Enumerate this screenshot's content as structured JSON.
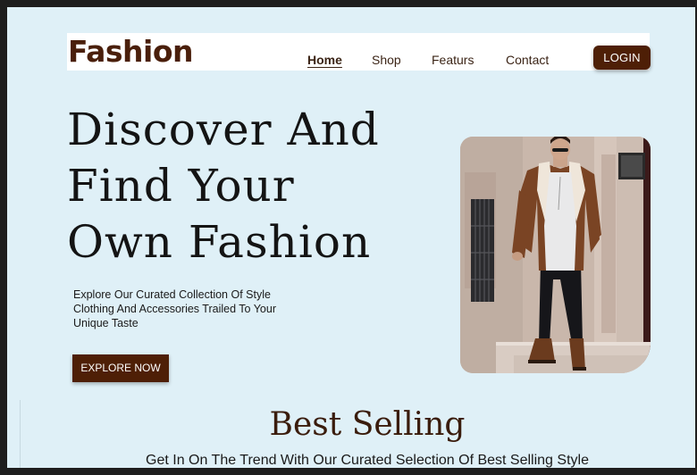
{
  "header": {
    "logo": "Fashion",
    "nav": [
      "Home",
      "Shop",
      "Featurs",
      "Contact"
    ],
    "login_label": "LOGIN"
  },
  "hero": {
    "title_lines": [
      "Discover And",
      "Find Your",
      "Own Fashion"
    ],
    "description": "Explore Our Curated Collection Of Style Clothing And Accessories Trailed To Your Unique Taste",
    "cta_label": "EXPLORE NOW"
  },
  "best_selling": {
    "title": "Best Selling",
    "subtitle": "Get In On The Trend With Our Curated Selection Of Best Selling Style"
  },
  "colors": {
    "background": "#dff0f7",
    "brand_brown": "#4e1f06",
    "header_bg": "#ffffff"
  }
}
